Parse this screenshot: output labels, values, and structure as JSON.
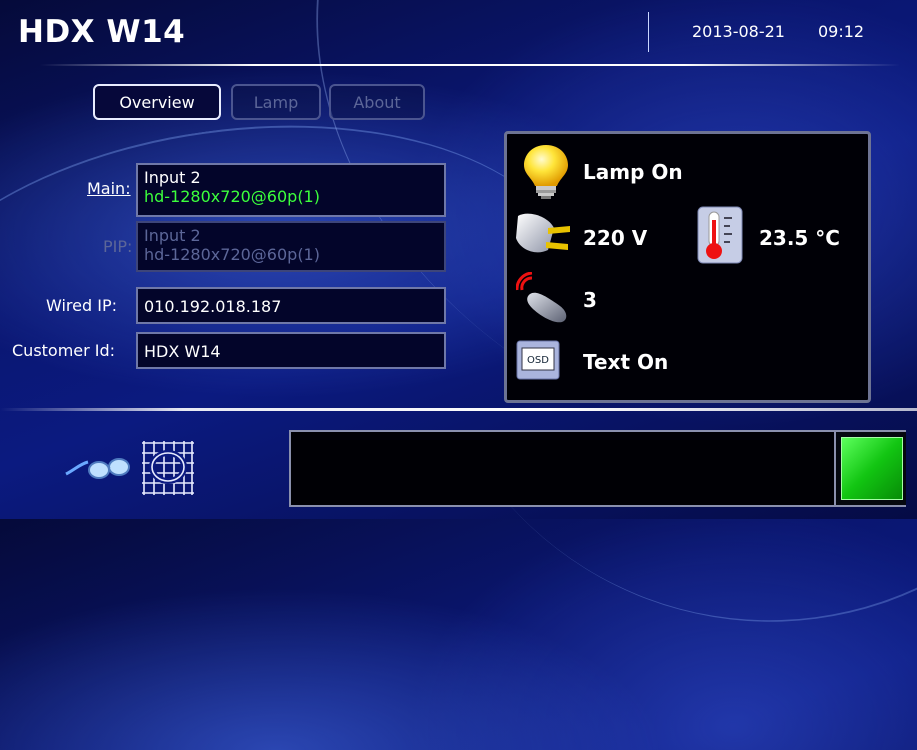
{
  "header": {
    "title": "HDX W14",
    "date": "2013-08-21",
    "time": "09:12"
  },
  "tabs": [
    {
      "label": "Overview",
      "active": true,
      "enabled": true
    },
    {
      "label": "Lamp",
      "active": false,
      "enabled": false
    },
    {
      "label": "About",
      "active": false,
      "enabled": false
    }
  ],
  "fields": {
    "main": {
      "label": "Main:",
      "line1": "Input 2",
      "line2": "hd-1280x720@60p(1)"
    },
    "pip": {
      "label": "PIP:",
      "line1": "Input 2",
      "line2": "hd-1280x720@60p(1)"
    },
    "wired_ip": {
      "label": "Wired IP:",
      "value": "010.192.018.187"
    },
    "customer_id": {
      "label": "Customer Id:",
      "value": "HDX W14"
    }
  },
  "status": {
    "lamp": {
      "icon": "lightbulb-icon",
      "text": "Lamp On"
    },
    "voltage": {
      "icon": "power-plug-icon",
      "text": "220 V"
    },
    "temperature": {
      "icon": "thermometer-icon",
      "text": "23.5 °C"
    },
    "remote": {
      "icon": "remote-control-icon",
      "text": "3"
    },
    "osd": {
      "icon": "osd-icon",
      "icon_text": "OSD",
      "text": "Text On"
    }
  },
  "bottom": {
    "icons": [
      "3d-glasses-icon",
      "warp-grid-icon"
    ]
  },
  "colors": {
    "accent_green": "#3cff3c",
    "status_square": "#12c512",
    "disabled_text": "#5c6698"
  }
}
